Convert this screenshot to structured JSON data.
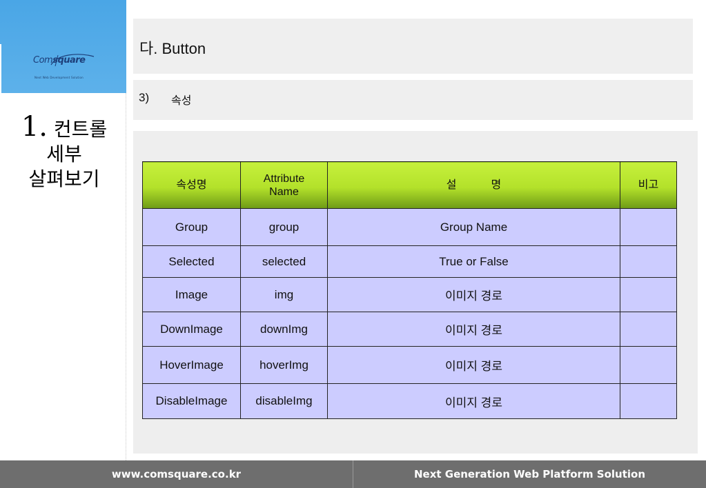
{
  "sidebar": {
    "logo": {
      "text_a": "Com",
      "text_b": "square",
      "tagline": "Next Web Development Solution"
    },
    "section": {
      "number": "1.",
      "line1": "컨트롤",
      "line2": "세부",
      "line3": "살펴보기"
    }
  },
  "header": {
    "title": "다. Button"
  },
  "subheader": {
    "number": "3)",
    "title": "속성"
  },
  "table": {
    "headers": {
      "name": "속성명",
      "attr_line1": "Attribute",
      "attr_line2": "Name",
      "desc_part1": "설",
      "desc_part2": "명",
      "note": "비고"
    },
    "rows": [
      {
        "name": "Group",
        "attr": "group",
        "desc": "Group Name",
        "note": ""
      },
      {
        "name": "Selected",
        "attr": "selected",
        "desc": "True or False",
        "note": ""
      },
      {
        "name": "Image",
        "attr": "img",
        "desc": "이미지 경로",
        "note": ""
      },
      {
        "name": "DownImage",
        "attr": "downImg",
        "desc": "이미지 경로",
        "note": ""
      },
      {
        "name": "HoverImage",
        "attr": "hoverImg",
        "desc": "이미지 경로",
        "note": ""
      },
      {
        "name": "DisableImage",
        "attr": "disableImg",
        "desc": "이미지 경로",
        "note": ""
      }
    ]
  },
  "footer": {
    "url": "www.comsquare.co.kr",
    "slogan": "Next Generation Web Platform Solution"
  },
  "colors": {
    "logo_bg": "#4aa6e6",
    "header_green": "#b3e12a",
    "cell_lavender": "#ccccff",
    "footer_gray": "#6e6e6e"
  }
}
